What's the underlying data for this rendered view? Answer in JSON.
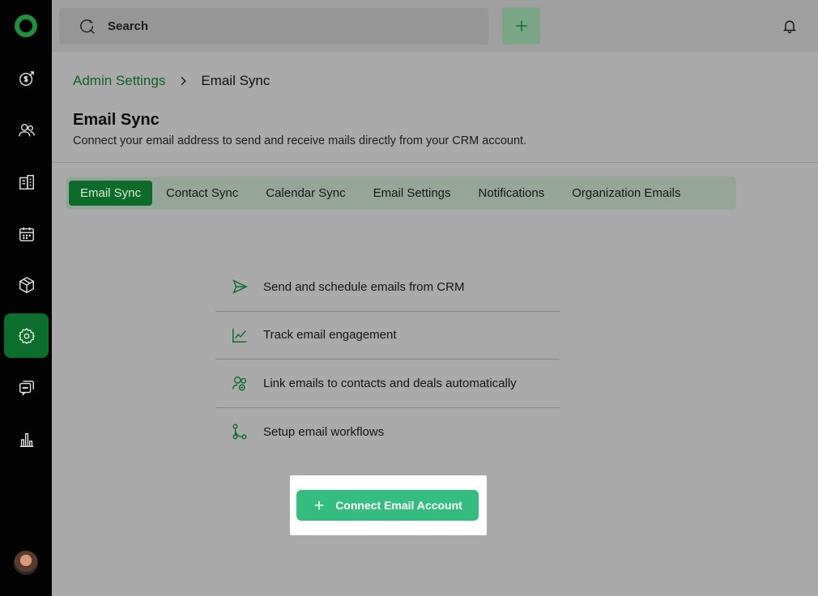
{
  "search": {
    "placeholder": "Search"
  },
  "breadcrumb": {
    "parent": "Admin Settings",
    "current": "Email Sync"
  },
  "page": {
    "title": "Email Sync",
    "subtitle": "Connect your email address to send and receive mails directly from your CRM account."
  },
  "tabs": [
    {
      "label": "Email Sync",
      "active": true
    },
    {
      "label": "Contact Sync"
    },
    {
      "label": "Calendar Sync"
    },
    {
      "label": "Email Settings"
    },
    {
      "label": "Notifications"
    },
    {
      "label": "Organization Emails"
    }
  ],
  "features": [
    {
      "icon": "send-icon",
      "text": "Send and schedule emails from CRM"
    },
    {
      "icon": "chart-line-icon",
      "text": "Track email engagement"
    },
    {
      "icon": "users-link-icon",
      "text": "Link emails to contacts and deals automatically"
    },
    {
      "icon": "workflow-icon",
      "text": "Setup email workflows"
    }
  ],
  "cta": {
    "label": "Connect Email Account"
  },
  "colors": {
    "accent": "#0b6e2a",
    "cta": "#34bd7e",
    "sidebar": "#030303"
  },
  "sidebar": {
    "items": [
      "deals-icon",
      "contacts-icon",
      "companies-icon",
      "calendar-icon",
      "products-icon",
      "settings-icon",
      "chat-icon",
      "reports-icon"
    ],
    "active": "settings-icon"
  }
}
